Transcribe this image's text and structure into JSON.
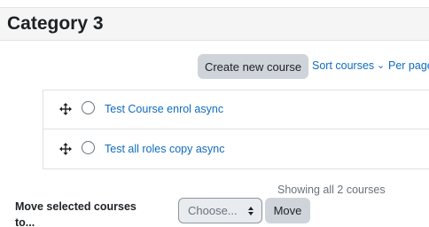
{
  "page": {
    "title": "Category 3"
  },
  "toolbar": {
    "create_label": "Create new course",
    "sort_label": "Sort courses",
    "sort_chevron": "⌄",
    "perpage_label": "Per page"
  },
  "courses": [
    {
      "name": "Test Course enrol async"
    },
    {
      "name": "Test all roles copy async"
    }
  ],
  "footer": {
    "showing_text": "Showing all 2 courses",
    "move_label": "Move selected courses to...",
    "choose_placeholder": "Choose...",
    "move_button_label": "Move"
  },
  "colors": {
    "link": "#0f6cbf",
    "button_bg": "#ced4da",
    "header_bg": "#f5f5f5"
  },
  "icons": {
    "drag": "move-arrows-icon",
    "select_arrows": "up-down-caret-icon"
  }
}
